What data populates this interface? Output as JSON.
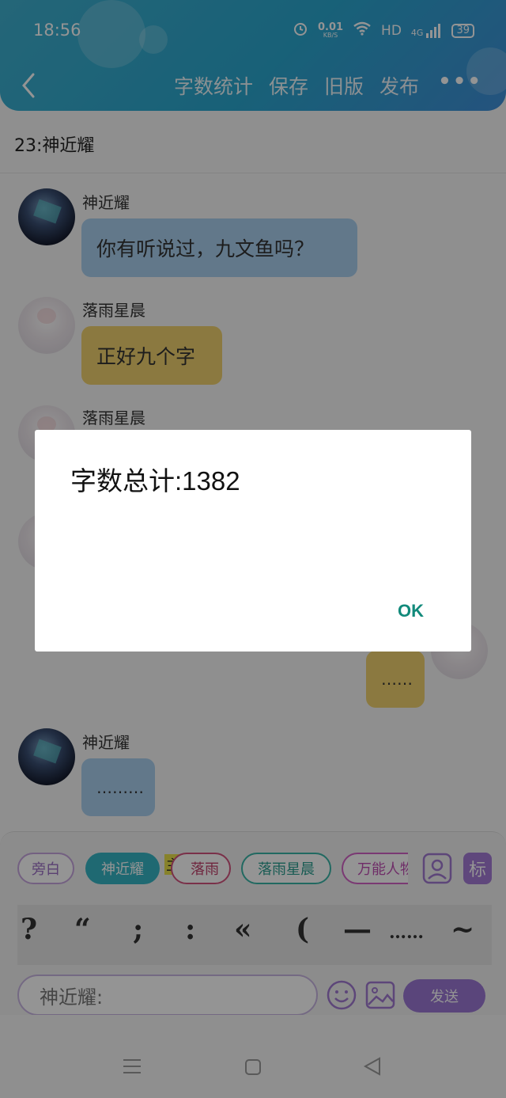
{
  "status_bar": {
    "time": "18:56",
    "net_speed_value": "0.01",
    "net_speed_unit": "KB/S",
    "hd": "HD",
    "network": "4G",
    "battery": "39"
  },
  "toolbar": {
    "menu": [
      "字数统计",
      "保存",
      "旧版",
      "发布"
    ],
    "more": "•••"
  },
  "chapter_title": "23:神近耀",
  "messages": [
    {
      "name": "神近耀",
      "text": "你有听说过，九文鱼吗？"
    },
    {
      "name": "落雨星晨",
      "text": "正好九个字"
    },
    {
      "name": "落雨星晨"
    },
    {
      "text": "……"
    },
    {
      "name": "神近耀",
      "text": "………"
    }
  ],
  "dialog": {
    "title": "字数总计:1382",
    "ok_label": "OK"
  },
  "composer": {
    "chips": [
      "旁白",
      "神近耀",
      "落雨",
      "落雨星晨",
      "万能人物"
    ],
    "tag_badge": "主",
    "mark_button": "标",
    "punctuation": [
      "?",
      "“",
      ";",
      ":",
      "«",
      "(",
      "—",
      "……",
      "~"
    ],
    "input_value": "神近耀:",
    "send_label": "发送"
  },
  "colors": {
    "header_gradient_start": "#3fb0cf",
    "header_gradient_end": "#3f8fd8",
    "bubble_blue": "#a9cfee",
    "bubble_yellow": "#f0d16e",
    "ok_color": "#128a7b",
    "send_color": "#9c77d4"
  }
}
